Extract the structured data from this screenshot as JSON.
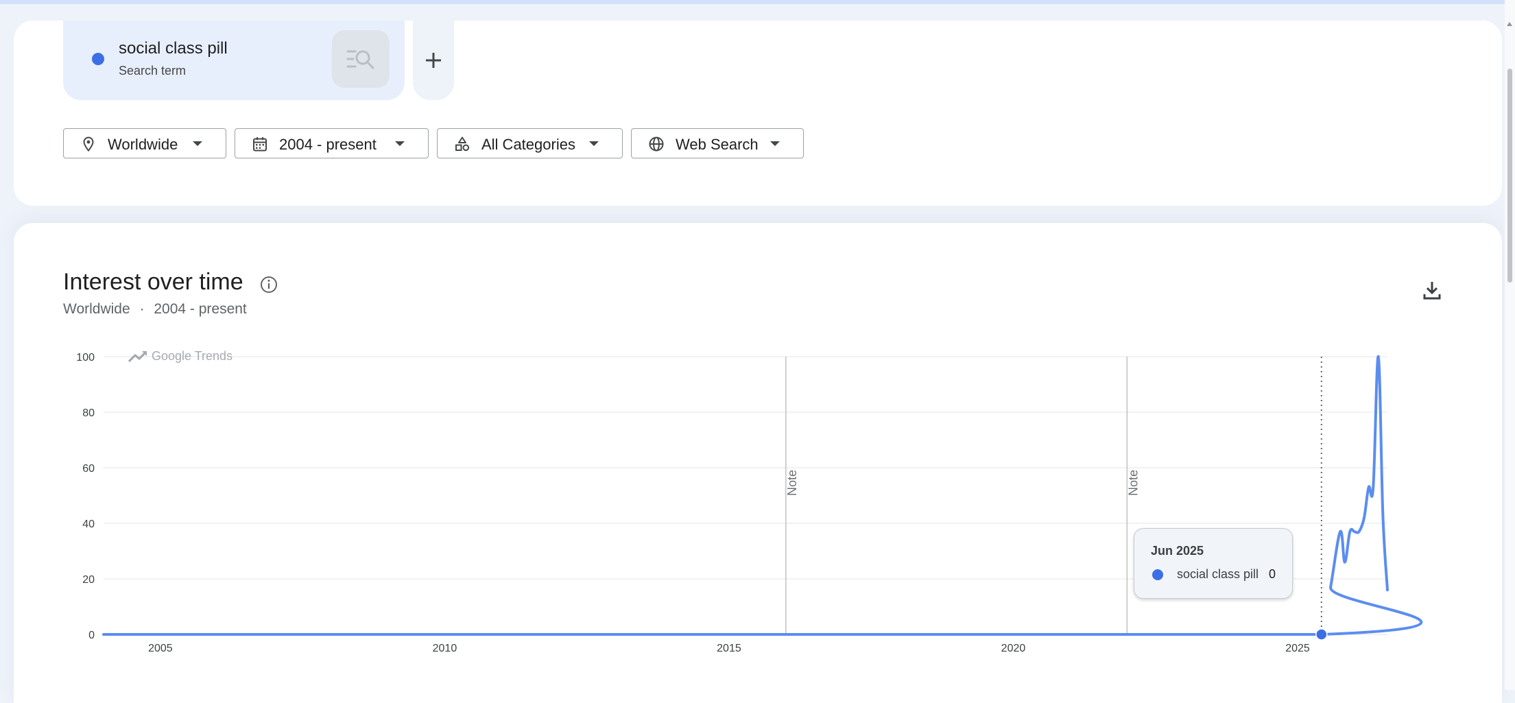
{
  "search_term": {
    "name": "social class pill",
    "type": "Search term",
    "color": "#3b6fe5"
  },
  "filters": {
    "region": "Worldwide",
    "time_range": "2004 - present",
    "category": "All Categories",
    "search_type": "Web Search"
  },
  "icons": [
    "compare-search-icon",
    "plus-icon",
    "location-pin-icon",
    "calendar-icon",
    "categories-icon",
    "globe-icon",
    "info-icon",
    "download-icon",
    "trend-icon"
  ],
  "chart": {
    "title": "Interest over time",
    "subtitle_region": "Worldwide",
    "subtitle_separator": "·",
    "subtitle_range": "2004 - present",
    "watermark": "Google Trends",
    "note_label": "Note"
  },
  "tooltip": {
    "date": "Jun 2025",
    "series": "social class pill",
    "value": "0"
  },
  "chart_data": {
    "type": "line",
    "ylim": [
      0,
      100
    ],
    "yticks": [
      0,
      20,
      40,
      60,
      80,
      100
    ],
    "xticks": [
      "2005",
      "2010",
      "2015",
      "2020",
      "2025"
    ],
    "xlim": [
      2004.0,
      2026.58
    ],
    "notes_at": [
      2016.0,
      2022.0
    ],
    "hover_x": 2025.42,
    "grid": true,
    "series": [
      {
        "name": "social class pill",
        "color": "#5b8def",
        "x": [
          2004.0,
          2025.42,
          2025.58,
          2025.75,
          2025.83,
          2025.92,
          2026.0,
          2026.08,
          2026.17,
          2026.25,
          2026.33,
          2026.42,
          2026.5,
          2026.58
        ],
        "y": [
          0,
          0,
          17,
          37,
          26,
          37,
          37,
          37,
          42,
          53,
          53,
          100,
          43,
          16
        ]
      }
    ]
  }
}
